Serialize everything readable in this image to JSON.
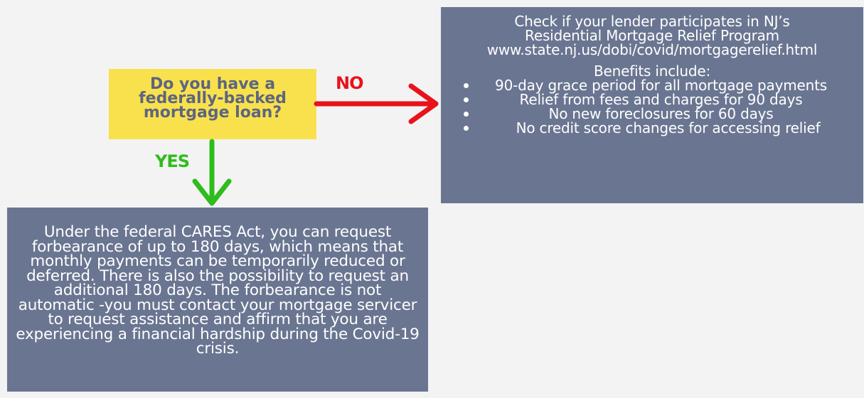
{
  "question": {
    "lines": [
      "Do you have a",
      "federally-backed",
      "mortgage loan?"
    ]
  },
  "no_label": "NO",
  "yes_label": "YES",
  "nj_program": {
    "lines": [
      "Check if your lender participates in NJ’s",
      "Residential Mortgage Relief Program",
      "www.state.nj.us/dobi/covid/mortgagerelief.html"
    ],
    "benefits_title": "Benefits include:",
    "benefits": [
      "90-day grace period for all mortgage payments",
      "Relief from fees and charges for 90 days",
      "No new foreclosures for 60 days",
      "No credit score changes for accessing relief"
    ]
  },
  "cares_act": {
    "text": "Under the federal CARES Act, you can request forbearance of up to 180 days, which means that monthly payments can be temporarily reduced or deferred.  There is also the possibility to request an additional 180 days. The forbearance is not automatic -you must contact your mortgage servicer to request assistance and affirm that you are experiencing a financial hardship during the Covid-19 crisis."
  },
  "colors": {
    "box_fill": "#6a7591",
    "question_fill": "#f8e14d",
    "question_text": "#5d6580",
    "no_arrow": "#e8131b",
    "yes_arrow": "#2fbc1c"
  }
}
